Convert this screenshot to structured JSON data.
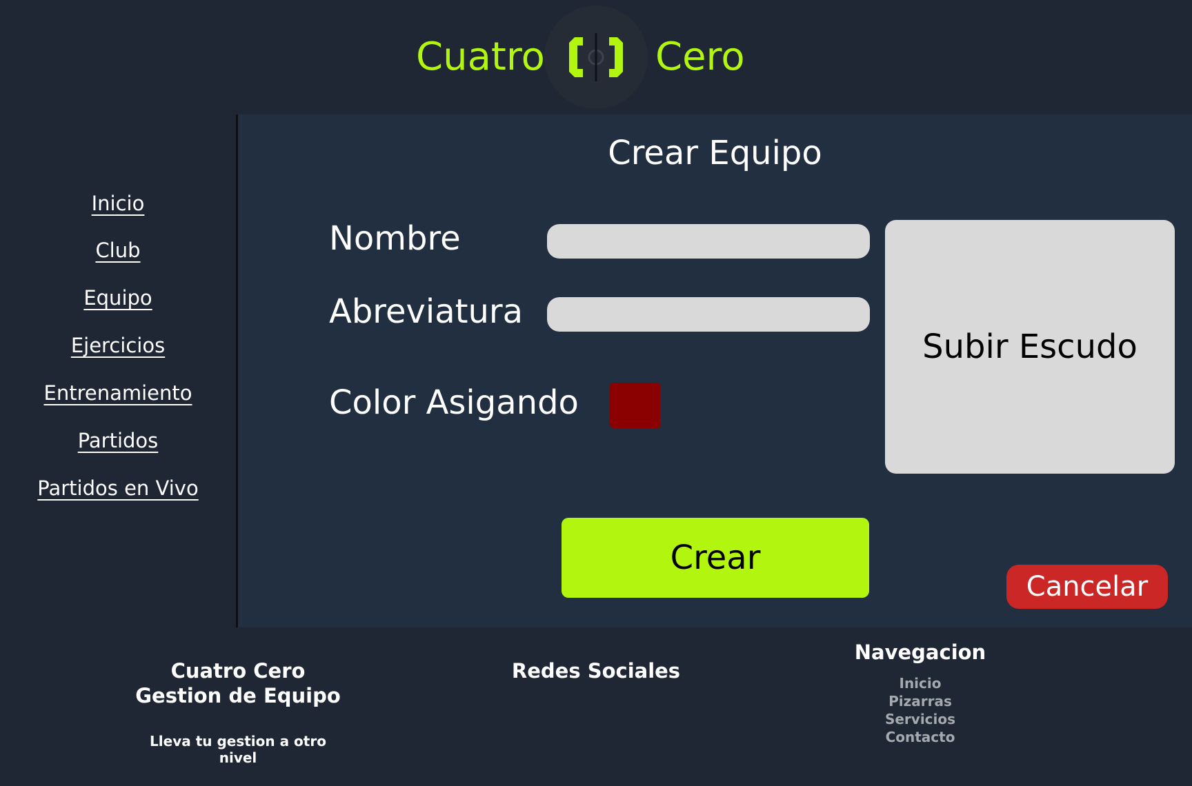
{
  "header": {
    "brand_left": "Cuatro",
    "brand_right": "Cero",
    "accent_color": "#b2f50f"
  },
  "sidebar": {
    "items": [
      {
        "label": "Inicio"
      },
      {
        "label": "Club"
      },
      {
        "label": "Equipo"
      },
      {
        "label": "Ejercicios"
      },
      {
        "label": "Entrenamiento"
      },
      {
        "label": "Partidos"
      },
      {
        "label": "Partidos en Vivo"
      }
    ]
  },
  "form": {
    "title": "Crear Equipo",
    "nombre_label": "Nombre",
    "nombre_value": "",
    "abreviatura_label": "Abreviatura",
    "abreviatura_value": "",
    "color_label": "Color Asigando",
    "color_value": "#8b0000",
    "upload_label": "Subir Escudo",
    "create_label": "Crear",
    "cancel_label": "Cancelar"
  },
  "footer": {
    "brand_line1": "Cuatro Cero",
    "brand_line2": "Gestion de Equipo",
    "tagline": "Lleva tu gestion a otro nivel",
    "social_title": "Redes Sociales",
    "nav_title": "Navegacion",
    "nav_links": [
      "Inicio",
      "Pizarras",
      "Servicios",
      "Contacto"
    ]
  }
}
